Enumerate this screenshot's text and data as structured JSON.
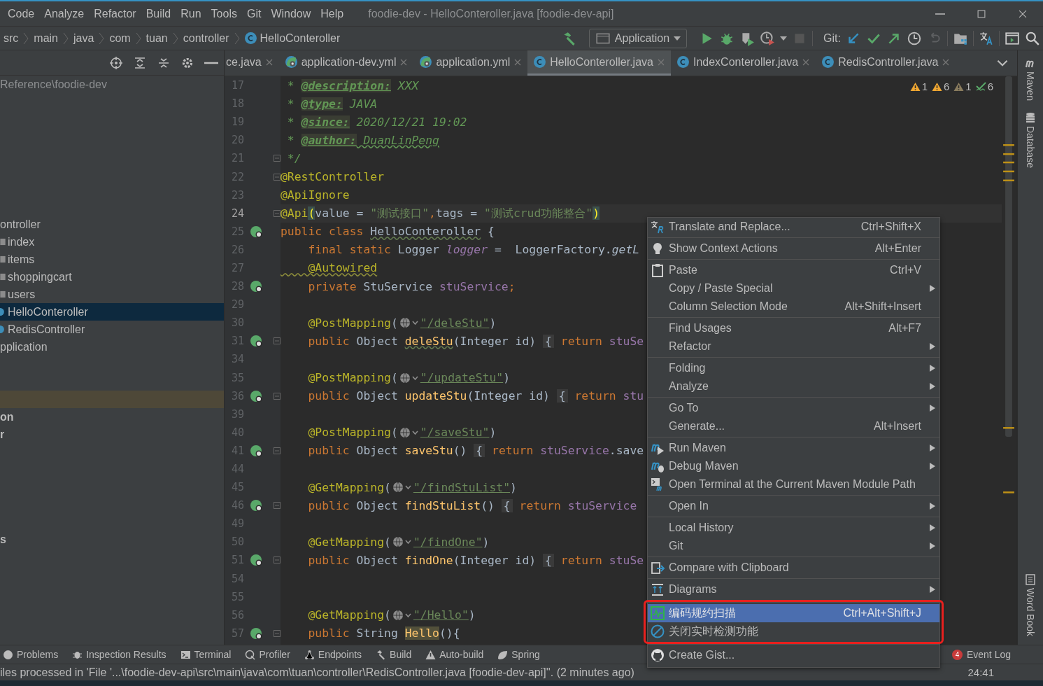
{
  "window": {
    "title": "foodie-dev - HelloConteroller.java [foodie-dev-api]"
  },
  "menu_bar": [
    "Code",
    "Analyze",
    "Refactor",
    "Build",
    "Run",
    "Tools",
    "Git",
    "Window",
    "Help"
  ],
  "breadcrumbs": [
    {
      "label": "src",
      "kind": "folder"
    },
    {
      "label": "main",
      "kind": "folder"
    },
    {
      "label": "java",
      "kind": "folder"
    },
    {
      "label": "com",
      "kind": "folder"
    },
    {
      "label": "tuan",
      "kind": "folder"
    },
    {
      "label": "controller",
      "kind": "folder"
    },
    {
      "label": "HelloConteroller",
      "kind": "class"
    }
  ],
  "toolbar": {
    "run_config": "Application",
    "git_label": "Git:"
  },
  "project_tree": [
    {
      "label": "Reference\\foodie-dev",
      "kind": "path",
      "selected": false
    },
    {
      "label": "ontroller",
      "kind": "package",
      "selected": false,
      "children": [
        {
          "label": "index",
          "kind": "folder",
          "selected": false
        },
        {
          "label": "items",
          "kind": "folder",
          "selected": false
        },
        {
          "label": "shoppingcart",
          "kind": "folder",
          "selected": false
        },
        {
          "label": "users",
          "kind": "folder",
          "selected": false
        },
        {
          "label": "HelloConteroller",
          "kind": "class",
          "selected": true
        },
        {
          "label": "RedisController",
          "kind": "class",
          "selected": false
        }
      ]
    },
    {
      "label": "pplication",
      "kind": "plain",
      "selected": false
    },
    {
      "kind": "marked",
      "selected": false
    },
    {
      "label": "on",
      "kind": "module",
      "selected": false
    },
    {
      "label": "r",
      "kind": "module",
      "selected": false
    },
    {
      "label": "s",
      "kind": "module",
      "selected": false
    }
  ],
  "tabs": [
    {
      "label": "ce.java",
      "kind": "plain",
      "selected": false
    },
    {
      "label": "application-dev.yml",
      "kind": "yml",
      "selected": false
    },
    {
      "label": "application.yml",
      "kind": "yml",
      "selected": false
    },
    {
      "label": "HelloConteroller.java",
      "kind": "class",
      "selected": true
    },
    {
      "label": "IndexConteroller.java",
      "kind": "class",
      "selected": false
    },
    {
      "label": "RedisController.java",
      "kind": "class",
      "selected": false
    }
  ],
  "inspections": [
    {
      "kind": "warning",
      "count": "1"
    },
    {
      "kind": "warning",
      "count": "6"
    },
    {
      "kind": "weak",
      "count": "1"
    },
    {
      "kind": "typo",
      "count": "6"
    }
  ],
  "code_lines": [
    {
      "number": "17",
      "current": false,
      "gutter_icon": false,
      "fold": false,
      "segments": [
        {
          "kind": "c",
          "text": " * "
        },
        {
          "kind": "dt",
          "text": "@description:"
        },
        {
          "kind": "c",
          "text": " XXX"
        }
      ]
    },
    {
      "number": "18",
      "current": false,
      "gutter_icon": false,
      "fold": false,
      "segments": [
        {
          "kind": "c",
          "text": " * "
        },
        {
          "kind": "dt",
          "text": "@type:"
        },
        {
          "kind": "c",
          "text": " JAVA"
        }
      ]
    },
    {
      "number": "19",
      "current": false,
      "gutter_icon": false,
      "fold": false,
      "segments": [
        {
          "kind": "c",
          "text": " * "
        },
        {
          "kind": "dt",
          "text": "@since:"
        },
        {
          "kind": "c",
          "text": " 2020/12/21 19:02"
        }
      ]
    },
    {
      "number": "20",
      "current": false,
      "gutter_icon": false,
      "fold": false,
      "segments": [
        {
          "kind": "c",
          "text": " * "
        },
        {
          "kind": "dt",
          "text": "@author:"
        },
        {
          "kind": "cu",
          "text": " DuanLinPeng"
        }
      ]
    },
    {
      "number": "21",
      "current": false,
      "gutter_icon": false,
      "fold": true,
      "segments": [
        {
          "kind": "c",
          "text": " */"
        }
      ]
    },
    {
      "number": "22",
      "current": false,
      "gutter_icon": false,
      "fold": true,
      "segments": [
        {
          "kind": "ann",
          "text": "@RestController"
        }
      ]
    },
    {
      "number": "23",
      "current": false,
      "gutter_icon": false,
      "fold": false,
      "segments": [
        {
          "kind": "ann",
          "text": "@ApiIgnore"
        }
      ]
    },
    {
      "number": "24",
      "current": true,
      "gutter_icon": false,
      "fold": true,
      "segments": [
        {
          "kind": "ann",
          "text": "@Api"
        },
        {
          "kind": "brace",
          "text": "("
        },
        {
          "kind": "pl",
          "text": "value = "
        },
        {
          "kind": "str",
          "text": "\"测试接口\""
        },
        {
          "kind": "kw",
          "text": ","
        },
        {
          "kind": "pl",
          "text": "tags = "
        },
        {
          "kind": "str",
          "text": "\"测试crud功能整合\""
        },
        {
          "kind": "brace",
          "text": ")"
        }
      ]
    },
    {
      "number": "25",
      "current": false,
      "gutter_icon": true,
      "fold": false,
      "segments": [
        {
          "kind": "kw",
          "text": "public class "
        },
        {
          "kind": "plu",
          "text": "HelloConteroller"
        },
        {
          "kind": "pl",
          "text": " {"
        }
      ]
    },
    {
      "number": "26",
      "current": false,
      "gutter_icon": false,
      "fold": false,
      "segments": [
        {
          "kind": "kw",
          "text": "    final static "
        },
        {
          "kind": "pl",
          "text": "Logger "
        },
        {
          "kind": "fldi",
          "text": "logger"
        },
        {
          "kind": "pl",
          "text": " =  LoggerFactory."
        },
        {
          "kind": "it",
          "text": "getL"
        }
      ]
    },
    {
      "number": "27",
      "current": false,
      "gutter_icon": false,
      "fold": false,
      "segments": [
        {
          "kind": "annu",
          "text": "    @Autowired"
        }
      ]
    },
    {
      "number": "28",
      "current": false,
      "gutter_icon": true,
      "fold": false,
      "segments": [
        {
          "kind": "kw",
          "text": "    private "
        },
        {
          "kind": "pl",
          "text": "StuService "
        },
        {
          "kind": "fld",
          "text": "stuService"
        },
        {
          "kind": "kw",
          "text": ";"
        }
      ]
    },
    {
      "number": "29",
      "current": false,
      "gutter_icon": false,
      "fold": false
    },
    {
      "number": "30",
      "current": false,
      "gutter_icon": false,
      "fold": false,
      "segments": [
        {
          "kind": "ann",
          "text": "    @PostMapping"
        },
        {
          "kind": "pl",
          "text": "("
        },
        {
          "kind": "inlay"
        },
        {
          "kind": "url",
          "text": "\"/deleStu\""
        },
        {
          "kind": "pl",
          "text": ")"
        }
      ]
    },
    {
      "number": "31",
      "current": false,
      "gutter_icon": true,
      "fold": true,
      "segments": [
        {
          "kind": "kw",
          "text": "    public "
        },
        {
          "kind": "pl",
          "text": "Object "
        },
        {
          "kind": "mthu",
          "text": "deleStu"
        },
        {
          "kind": "pl",
          "text": "(Integer id) "
        },
        {
          "kind": "foldbox",
          "text": "{"
        },
        {
          "kind": "kw",
          "text": " return "
        },
        {
          "kind": "fld",
          "text": "stuSe"
        }
      ]
    },
    {
      "number": "34",
      "current": false,
      "gutter_icon": false,
      "fold": false
    },
    {
      "number": "35",
      "current": false,
      "gutter_icon": false,
      "fold": false,
      "segments": [
        {
          "kind": "ann",
          "text": "    @PostMapping"
        },
        {
          "kind": "pl",
          "text": "("
        },
        {
          "kind": "inlay"
        },
        {
          "kind": "url",
          "text": "\"/updateStu\""
        },
        {
          "kind": "pl",
          "text": ")"
        }
      ]
    },
    {
      "number": "36",
      "current": false,
      "gutter_icon": true,
      "fold": true,
      "segments": [
        {
          "kind": "kw",
          "text": "    public "
        },
        {
          "kind": "pl",
          "text": "Object "
        },
        {
          "kind": "mth",
          "text": "updateStu"
        },
        {
          "kind": "pl",
          "text": "(Integer id) "
        },
        {
          "kind": "foldbox",
          "text": "{"
        },
        {
          "kind": "kw",
          "text": " return "
        },
        {
          "kind": "fld",
          "text": "stu"
        }
      ]
    },
    {
      "number": "39",
      "current": false,
      "gutter_icon": false,
      "fold": false
    },
    {
      "number": "40",
      "current": false,
      "gutter_icon": false,
      "fold": false,
      "segments": [
        {
          "kind": "ann",
          "text": "    @PostMapping"
        },
        {
          "kind": "pl",
          "text": "("
        },
        {
          "kind": "inlay"
        },
        {
          "kind": "url",
          "text": "\"/saveStu\""
        },
        {
          "kind": "pl",
          "text": ")"
        }
      ]
    },
    {
      "number": "41",
      "current": false,
      "gutter_icon": true,
      "fold": true,
      "segments": [
        {
          "kind": "kw",
          "text": "    public "
        },
        {
          "kind": "pl",
          "text": "Object "
        },
        {
          "kind": "mth",
          "text": "saveStu"
        },
        {
          "kind": "pl",
          "text": "() "
        },
        {
          "kind": "foldbox",
          "text": "{"
        },
        {
          "kind": "kw",
          "text": " return "
        },
        {
          "kind": "fld",
          "text": "stuService"
        },
        {
          "kind": "pl",
          "text": ".save"
        }
      ]
    },
    {
      "number": "44",
      "current": false,
      "gutter_icon": false,
      "fold": false
    },
    {
      "number": "45",
      "current": false,
      "gutter_icon": false,
      "fold": false,
      "segments": [
        {
          "kind": "ann",
          "text": "    @GetMapping"
        },
        {
          "kind": "pl",
          "text": "("
        },
        {
          "kind": "inlay"
        },
        {
          "kind": "url",
          "text": "\"/findStuList\""
        },
        {
          "kind": "pl",
          "text": ")"
        }
      ]
    },
    {
      "number": "46",
      "current": false,
      "gutter_icon": true,
      "fold": true,
      "segments": [
        {
          "kind": "kw",
          "text": "    public "
        },
        {
          "kind": "pl",
          "text": "Object "
        },
        {
          "kind": "mth",
          "text": "findStuList"
        },
        {
          "kind": "pl",
          "text": "() "
        },
        {
          "kind": "foldbox",
          "text": "{"
        },
        {
          "kind": "kw",
          "text": " return "
        },
        {
          "kind": "fld",
          "text": "stuService"
        }
      ]
    },
    {
      "number": "49",
      "current": false,
      "gutter_icon": false,
      "fold": false
    },
    {
      "number": "50",
      "current": false,
      "gutter_icon": false,
      "fold": false,
      "segments": [
        {
          "kind": "ann",
          "text": "    @GetMapping"
        },
        {
          "kind": "pl",
          "text": "("
        },
        {
          "kind": "inlay"
        },
        {
          "kind": "url",
          "text": "\"/findOne\""
        },
        {
          "kind": "pl",
          "text": ")"
        }
      ]
    },
    {
      "number": "51",
      "current": false,
      "gutter_icon": true,
      "fold": true,
      "segments": [
        {
          "kind": "kw",
          "text": "    public "
        },
        {
          "kind": "pl",
          "text": "Object "
        },
        {
          "kind": "mth",
          "text": "findOne"
        },
        {
          "kind": "pl",
          "text": "(Integer id) "
        },
        {
          "kind": "foldbox",
          "text": "{"
        },
        {
          "kind": "kw",
          "text": " return "
        },
        {
          "kind": "fld",
          "text": "stuSe"
        }
      ]
    },
    {
      "number": "54",
      "current": false,
      "gutter_icon": false,
      "fold": false
    },
    {
      "number": "55",
      "current": false,
      "gutter_icon": false,
      "fold": false
    },
    {
      "number": "56",
      "current": false,
      "gutter_icon": false,
      "fold": false,
      "segments": [
        {
          "kind": "ann",
          "text": "    @GetMapping"
        },
        {
          "kind": "pl",
          "text": "("
        },
        {
          "kind": "inlay"
        },
        {
          "kind": "url",
          "text": "\"/Hello\""
        },
        {
          "kind": "pl",
          "text": ")"
        }
      ]
    },
    {
      "number": "57",
      "current": false,
      "gutter_icon": true,
      "fold": true,
      "segments": [
        {
          "kind": "kw",
          "text": "    public "
        },
        {
          "kind": "pl",
          "text": "String "
        },
        {
          "kind": "hl",
          "text": "Hello"
        },
        {
          "kind": "pl",
          "text": "(){"
        }
      ]
    }
  ],
  "right_strip": [
    {
      "label": "Maven",
      "kind": "maven"
    },
    {
      "label": "Database",
      "kind": "database"
    },
    {
      "label": "Word Book",
      "kind": "book"
    }
  ],
  "context_menu": [
    {
      "outlined": false,
      "items": [
        {
          "kind": "translate",
          "label": "Translate and Replace...",
          "shortcut": "Ctrl+Shift+X",
          "submenu": false,
          "selected": false
        }
      ]
    },
    {
      "outlined": false,
      "items": [
        {
          "kind": "bulb",
          "label": "Show Context Actions",
          "shortcut": "Alt+Enter",
          "submenu": false,
          "selected": false
        }
      ]
    },
    {
      "outlined": false,
      "items": [
        {
          "kind": "paste",
          "label": "Paste",
          "shortcut": "Ctrl+V",
          "submenu": false,
          "selected": false
        },
        {
          "kind": "plain",
          "label": "Copy / Paste Special",
          "submenu": true,
          "selected": false
        },
        {
          "kind": "plain",
          "label": "Column Selection Mode",
          "shortcut": "Alt+Shift+Insert",
          "submenu": false,
          "selected": false
        }
      ]
    },
    {
      "outlined": false,
      "items": [
        {
          "kind": "plain",
          "label": "Find Usages",
          "shortcut": "Alt+F7",
          "submenu": false,
          "selected": false
        },
        {
          "kind": "plain",
          "label": "Refactor",
          "submenu": true,
          "selected": false
        }
      ]
    },
    {
      "outlined": false,
      "items": [
        {
          "kind": "plain",
          "label": "Folding",
          "submenu": true,
          "selected": false
        },
        {
          "kind": "plain",
          "label": "Analyze",
          "submenu": true,
          "selected": false
        }
      ]
    },
    {
      "outlined": false,
      "items": [
        {
          "kind": "plain",
          "label": "Go To",
          "submenu": true,
          "selected": false
        },
        {
          "kind": "plain",
          "label": "Generate...",
          "shortcut": "Alt+Insert",
          "submenu": false,
          "selected": false
        }
      ]
    },
    {
      "outlined": false,
      "items": [
        {
          "kind": "maven-run",
          "label": "Run Maven",
          "submenu": true,
          "selected": false
        },
        {
          "kind": "maven-debug",
          "label": "Debug Maven",
          "submenu": true,
          "selected": false
        },
        {
          "kind": "maven-terminal",
          "label": "Open Terminal at the Current Maven Module Path",
          "submenu": false,
          "selected": false
        }
      ]
    },
    {
      "outlined": false,
      "items": [
        {
          "kind": "plain",
          "label": "Open In",
          "submenu": true,
          "selected": false
        }
      ]
    },
    {
      "outlined": false,
      "items": [
        {
          "kind": "plain",
          "label": "Local History",
          "submenu": true,
          "selected": false
        },
        {
          "kind": "plain",
          "label": "Git",
          "submenu": true,
          "selected": false
        }
      ]
    },
    {
      "outlined": false,
      "items": [
        {
          "kind": "compare",
          "label": "Compare with Clipboard",
          "submenu": false,
          "selected": false
        }
      ]
    },
    {
      "outlined": false,
      "items": [
        {
          "kind": "diagram",
          "label": "Diagrams",
          "submenu": true,
          "selected": false
        }
      ]
    },
    {
      "outlined": true,
      "items": [
        {
          "kind": "scan",
          "label": "编码规约扫描",
          "shortcut": "Ctrl+Alt+Shift+J",
          "submenu": false,
          "selected": true
        },
        {
          "kind": "forbid",
          "label": "关闭实时检测功能",
          "submenu": false,
          "selected": false
        }
      ]
    },
    {
      "outlined": false,
      "items": [
        {
          "kind": "github",
          "label": "Create Gist...",
          "submenu": false,
          "selected": false
        }
      ]
    }
  ],
  "tool_windows": [
    {
      "label": "Problems",
      "kind": "problems"
    },
    {
      "label": "Inspection Results",
      "kind": "inspect"
    },
    {
      "label": "Terminal",
      "kind": "terminal"
    },
    {
      "label": "Profiler",
      "kind": "profiler"
    },
    {
      "label": "Endpoints",
      "kind": "endpoints"
    },
    {
      "label": "Build",
      "kind": "build"
    },
    {
      "label": "Auto-build",
      "kind": "warning"
    },
    {
      "label": "Spring",
      "kind": "spring"
    }
  ],
  "event_log": {
    "label": "Event Log",
    "badge": "4"
  },
  "status_bar": {
    "message": "iles processed in 'File '...\\foodie-dev-api\\src\\main\\java\\com\\tuan\\controller\\RedisController.java [foodie-dev-api]''. (2 minutes ago)",
    "position": "24:41"
  }
}
